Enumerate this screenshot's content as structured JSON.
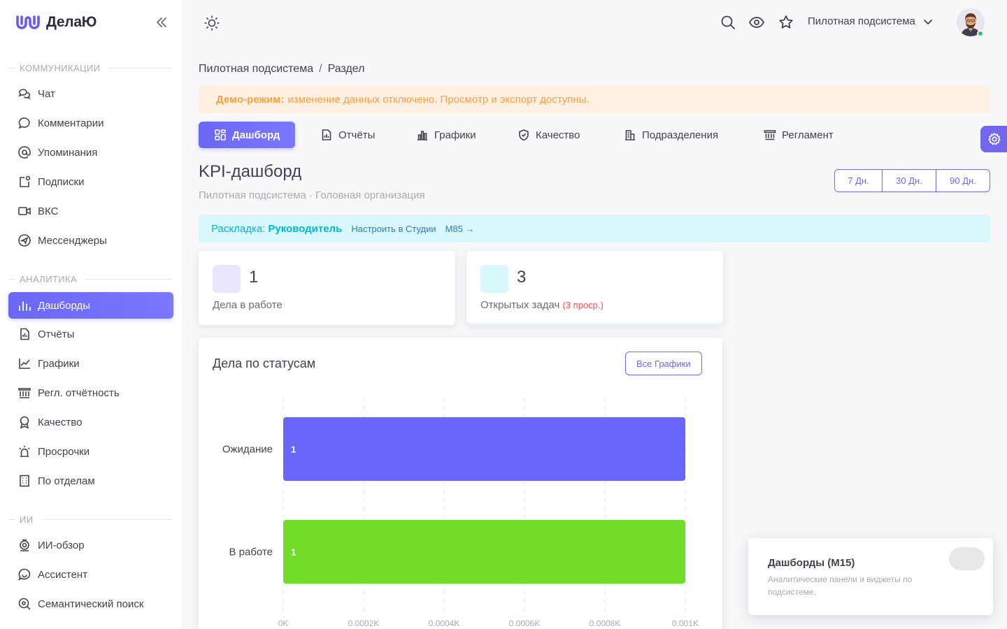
{
  "brand": {
    "name": "ДелаЮ"
  },
  "sidebar": {
    "sections": [
      {
        "title": "КОММУНИКАЦИИ"
      },
      {
        "title": "АНАЛИТИКА"
      },
      {
        "title": "ИИ"
      }
    ],
    "items": [
      {
        "label": "Чат",
        "icon": "chat-icon"
      },
      {
        "label": "Комментарии",
        "icon": "comment-icon"
      },
      {
        "label": "Упоминания",
        "icon": "at-icon"
      },
      {
        "label": "Подписки",
        "icon": "subscription-icon"
      },
      {
        "label": "ВКС",
        "icon": "video-icon"
      },
      {
        "label": "Мессенджеры",
        "icon": "send-icon"
      },
      {
        "label": "Дашборды",
        "icon": "bars-icon",
        "active": true
      },
      {
        "label": "Отчёты",
        "icon": "report-icon"
      },
      {
        "label": "Графики",
        "icon": "line-chart-icon"
      },
      {
        "label": "Регл. отчётность",
        "icon": "building-columns-icon"
      },
      {
        "label": "Качество",
        "icon": "award-icon"
      },
      {
        "label": "Просрочки",
        "icon": "alarm-icon"
      },
      {
        "label": "По отделам",
        "icon": "office-grid-icon"
      },
      {
        "label": "ИИ-обзор",
        "icon": "ai-camera-icon"
      },
      {
        "label": "Ассистент",
        "icon": "assistant-icon"
      },
      {
        "label": "Семантический поиск",
        "icon": "semantic-search-icon"
      }
    ]
  },
  "topbar": {
    "subsystem": "Пилотная подсистема"
  },
  "breadcrumb": {
    "root": "Пилотная подсистема",
    "sep": "/",
    "current": "Раздел"
  },
  "alert": {
    "bold": "Демо-режим:",
    "text": "изменение данных отключено. Просмотр и экспорт доступны."
  },
  "tabs": [
    {
      "label": "Дашборд",
      "icon": "dashboard-icon",
      "active": true
    },
    {
      "label": "Отчёты",
      "icon": "report-icon"
    },
    {
      "label": "Графики",
      "icon": "bar-chart-icon"
    },
    {
      "label": "Качество",
      "icon": "shield-check-icon"
    },
    {
      "label": "Подразделения",
      "icon": "building-icon"
    },
    {
      "label": "Регламент",
      "icon": "building-columns-icon"
    }
  ],
  "page": {
    "title": "KPI-дашборд",
    "subtitle": "Пилотная подсистема · Головная организация",
    "periods": [
      "7 Дн.",
      "30 Дн.",
      "90 Дн."
    ]
  },
  "layout_bar": {
    "prefix": "Раскладка:",
    "role": "Руководитель",
    "link": "Настроить в Студии",
    "module_link": "М85 →"
  },
  "kpis": [
    {
      "value": "1",
      "label": "Дела в работе",
      "color": "#e9e7fd"
    },
    {
      "value": "3",
      "label": "Открытых задач",
      "extra": "(3 просрочено)",
      "extra_shown": "(3 проср.)",
      "color": "#d9f8fc"
    }
  ],
  "chart_card": {
    "title": "Дела по статусам",
    "button": "Все Графики"
  },
  "chart_data": {
    "type": "bar",
    "orientation": "horizontal",
    "categories": [
      "Ожидание",
      "В работе"
    ],
    "values": [
      1,
      1
    ],
    "colors": [
      "#6966fb",
      "#71dd2a"
    ],
    "data_labels": [
      "1",
      "1"
    ],
    "x_ticks": [
      "0K",
      "0.0002K",
      "0.0004K",
      "0.0006K",
      "0.0008K",
      "0.001K"
    ],
    "xlim": [
      0,
      1
    ],
    "grid": true
  },
  "toast": {
    "title": "Дашборды (М15)",
    "text": "Аналитические панели и виджеты по подсистеме."
  },
  "colors": {
    "primary": "#7367f0",
    "warning": "#ff9f43",
    "info": "#00bad1",
    "danger": "#ff4c51",
    "success": "#28c76f"
  }
}
